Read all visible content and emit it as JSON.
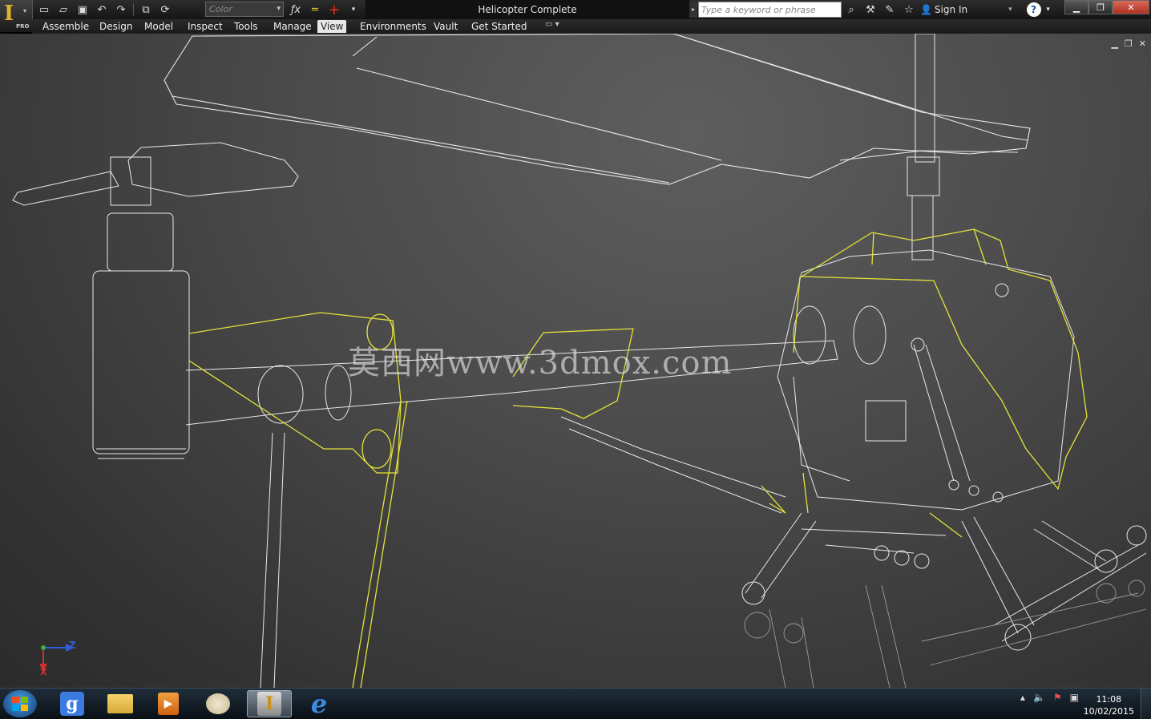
{
  "app": {
    "logo_letter": "I",
    "edition": "PRO"
  },
  "quick_access": {
    "icons": [
      "new-icon",
      "open-icon",
      "save-icon",
      "undo-icon",
      "redo-icon",
      "select-icon",
      "update-icon"
    ],
    "color_placeholder": "Color",
    "icons2": [
      "fx-icon",
      "measure-icon",
      "origin-icon"
    ]
  },
  "window": {
    "title": "Helicopter Complete"
  },
  "search": {
    "placeholder": "Type a keyword or phrase"
  },
  "account": {
    "sign_in": "Sign In"
  },
  "menus": [
    {
      "label": "Assemble"
    },
    {
      "label": "Design"
    },
    {
      "label": "Model"
    },
    {
      "label": "Inspect"
    },
    {
      "label": "Tools"
    },
    {
      "label": "Manage"
    },
    {
      "label": "View",
      "active": true
    },
    {
      "label": "Environments"
    },
    {
      "label": "Vault"
    },
    {
      "label": "Get Started"
    }
  ],
  "viewport": {
    "watermark": "莫西网www.3dmox.com",
    "axis": {
      "z": "Z",
      "x": "X"
    },
    "colors": {
      "wire": "#e8e8e8",
      "selected": "#e4e23a",
      "background": "#474747"
    }
  },
  "taskbar": {
    "apps": [
      "start-orb",
      "google-app",
      "file-explorer",
      "media-player",
      "paint-app",
      "inventor-app",
      "internet-explorer"
    ],
    "clock_time": "11:08",
    "clock_date": "10/02/2015"
  }
}
